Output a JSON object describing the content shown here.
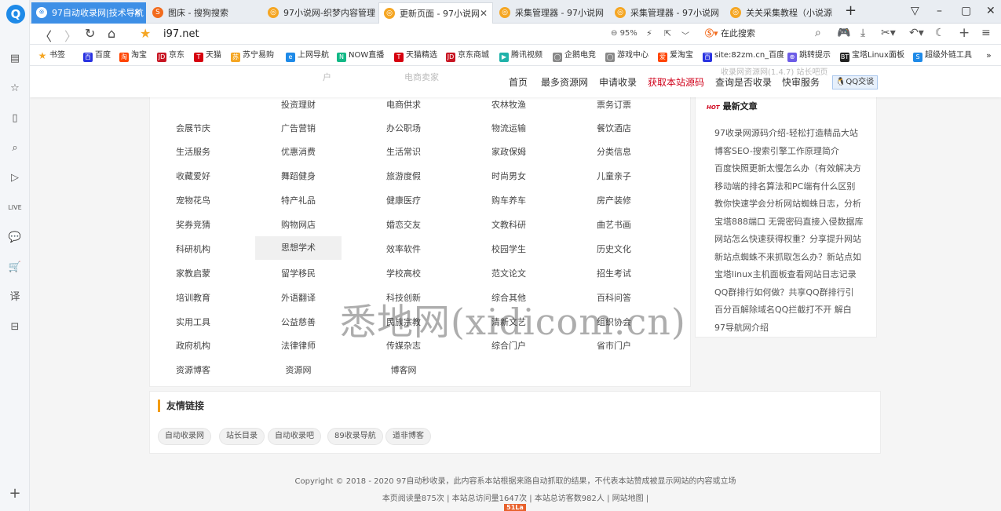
{
  "sidebar": {
    "plus": "+"
  },
  "tabs": [
    {
      "title": "97自动收录网|技术导航",
      "state": "highlighted"
    },
    {
      "title": "图床 - 搜狗搜索",
      "state": "normal"
    },
    {
      "title": "97小说网-织梦内容管理",
      "state": "normal"
    },
    {
      "title": "更新页面 - 97小说网",
      "state": "active"
    },
    {
      "title": "采集管理器 - 97小说网",
      "state": "normal"
    },
    {
      "title": "采集管理器 - 97小说网",
      "state": "normal"
    },
    {
      "title": "关关采集教程（小说源",
      "state": "normal"
    }
  ],
  "address": {
    "url": "i97.net",
    "zoom": "95%",
    "search_placeholder": "在此搜索"
  },
  "bookmarks": [
    "书签",
    "百度",
    "淘宝",
    "京东",
    "天猫",
    "苏宁易购",
    "上网导航",
    "NOW直播",
    "天猫精选",
    "京东商城",
    "腾讯视频",
    "企鹅电竞",
    "游戏中心",
    "爱淘宝",
    "site:82zm.cn_百度",
    "跳转提示",
    "宝塔Linux面板",
    "超级外链工具"
  ],
  "site": {
    "nav": [
      "首页",
      "最多资源网",
      "申请收录",
      "获取本站源码",
      "查询是否收录",
      "快审服务"
    ],
    "nav_highlight": "获取本站源码",
    "qq_label": "QQ交谈",
    "ghost": [
      "户",
      "电商卖家",
      "收录网资源网(1.4.7) 站长吧页"
    ]
  },
  "categories": [
    [
      "",
      "投资理财",
      "电商供求",
      "农林牧渔",
      "票务订票"
    ],
    [
      "会展节庆",
      "广告营销",
      "办公职场",
      "物流运输",
      "餐饮酒店"
    ],
    [
      "生活服务",
      "优惠消费",
      "生活常识",
      "家政保姆",
      "分类信息"
    ],
    [
      "收藏爱好",
      "舞蹈健身",
      "旅游度假",
      "时尚男女",
      "儿童亲子"
    ],
    [
      "宠物花鸟",
      "特产礼品",
      "健康医疗",
      "购车养车",
      "房产装修"
    ],
    [
      "奖券竞猜",
      "购物网店",
      "婚恋交友",
      "文教科研",
      "曲艺书画"
    ],
    [
      "科研机构",
      "思想学术",
      "效率软件",
      "校园学生",
      "历史文化"
    ],
    [
      "家教启蒙",
      "留学移民",
      "学校高校",
      "范文论文",
      "招生考试"
    ],
    [
      "培训教育",
      "外语翻译",
      "科技创新",
      "综合其他",
      "百科问答"
    ],
    [
      "实用工具",
      "公益慈善",
      "民族宗教",
      "清新文艺",
      "组织协会"
    ],
    [
      "政府机构",
      "法律律师",
      "传媒杂志",
      "综合门户",
      "省市门户"
    ],
    [
      "资源博客",
      "资源网",
      "博客网",
      "",
      ""
    ]
  ],
  "latest": {
    "badge": "HOT",
    "title": "最新文章",
    "articles": [
      "97收录网源码介绍-轻松打造精品大站",
      "博客SEO-搜索引擎工作原理简介",
      "百度快照更新太慢怎么办（有效解决方",
      "移动端的排名算法和PC端有什么区别",
      "教你快速学会分析网站蜘蛛日志，分析",
      "宝塔888端口 无需密码直接入侵数据库",
      "网站怎么快速获得权重？分享提升网站",
      "新站点蜘蛛不来抓取怎么办？新站点如",
      "宝塔linux主机面板查看网站日志记录",
      "QQ群排行如何做？共享QQ群排行引",
      "百分百解除域名QQ拦截打不开 解白",
      "97导航网介绍"
    ]
  },
  "friend_links": {
    "title": "友情链接",
    "items": [
      "自动收录网",
      "站长目录",
      "自动收录吧",
      "89收录导航",
      "道非博客"
    ]
  },
  "footer": {
    "copyright": "Copyright © 2018 - 2020 97自动秒收录，此内容系本站根据来路自动抓取的结果，不代表本站赞成被显示网站的内容或立场",
    "stats": "本页阅读量875次 | 本站总访问量1647次 | 本站总访客数982人 | 网站地图 |",
    "badge": "51La"
  },
  "watermark": "悉地网(xidicom.cn)"
}
